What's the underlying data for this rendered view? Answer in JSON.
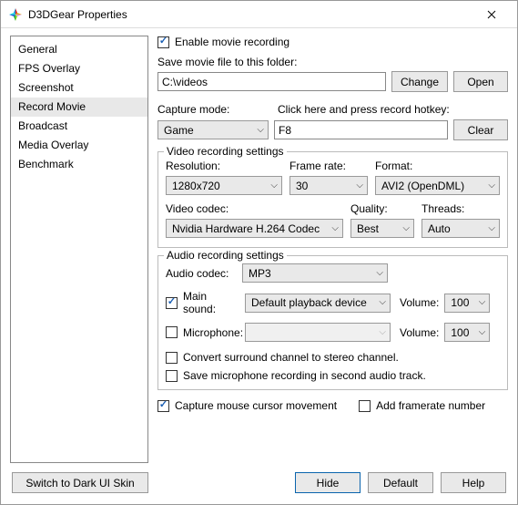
{
  "title": "D3DGear Properties",
  "sidebar": {
    "items": [
      {
        "label": "General"
      },
      {
        "label": "FPS Overlay"
      },
      {
        "label": "Screenshot"
      },
      {
        "label": "Record Movie"
      },
      {
        "label": "Broadcast"
      },
      {
        "label": "Media Overlay"
      },
      {
        "label": "Benchmark"
      }
    ]
  },
  "enable_label": "Enable movie recording",
  "save_folder_label": "Save movie file to this folder:",
  "save_folder_value": "C:\\videos",
  "change_btn": "Change",
  "open_btn": "Open",
  "capture_mode_label": "Capture mode:",
  "capture_mode_value": "Game",
  "hotkey_label": "Click here and press record hotkey:",
  "hotkey_value": "F8",
  "clear_btn": "Clear",
  "video_group": "Video recording settings",
  "resolution_label": "Resolution:",
  "resolution_value": "1280x720",
  "framerate_label": "Frame rate:",
  "framerate_value": "30",
  "format_label": "Format:",
  "format_value": "AVI2 (OpenDML)",
  "codec_label": "Video codec:",
  "codec_value": "Nvidia Hardware H.264 Codec",
  "quality_label": "Quality:",
  "quality_value": "Best",
  "threads_label": "Threads:",
  "threads_value": "Auto",
  "audio_group": "Audio recording settings",
  "audio_codec_label": "Audio codec:",
  "audio_codec_value": "MP3",
  "main_sound_label": "Main sound:",
  "main_sound_value": "Default playback device",
  "volume_label": "Volume:",
  "main_volume_value": "100",
  "mic_label": "Microphone:",
  "mic_volume_value": "100",
  "convert_label": "Convert surround channel to stereo channel.",
  "save_mic_label": "Save microphone recording in second audio track.",
  "cursor_label": "Capture mouse cursor movement",
  "framerate_num_label": "Add framerate number",
  "skin_btn": "Switch to Dark UI Skin",
  "hide_btn": "Hide",
  "default_btn": "Default",
  "help_btn": "Help"
}
